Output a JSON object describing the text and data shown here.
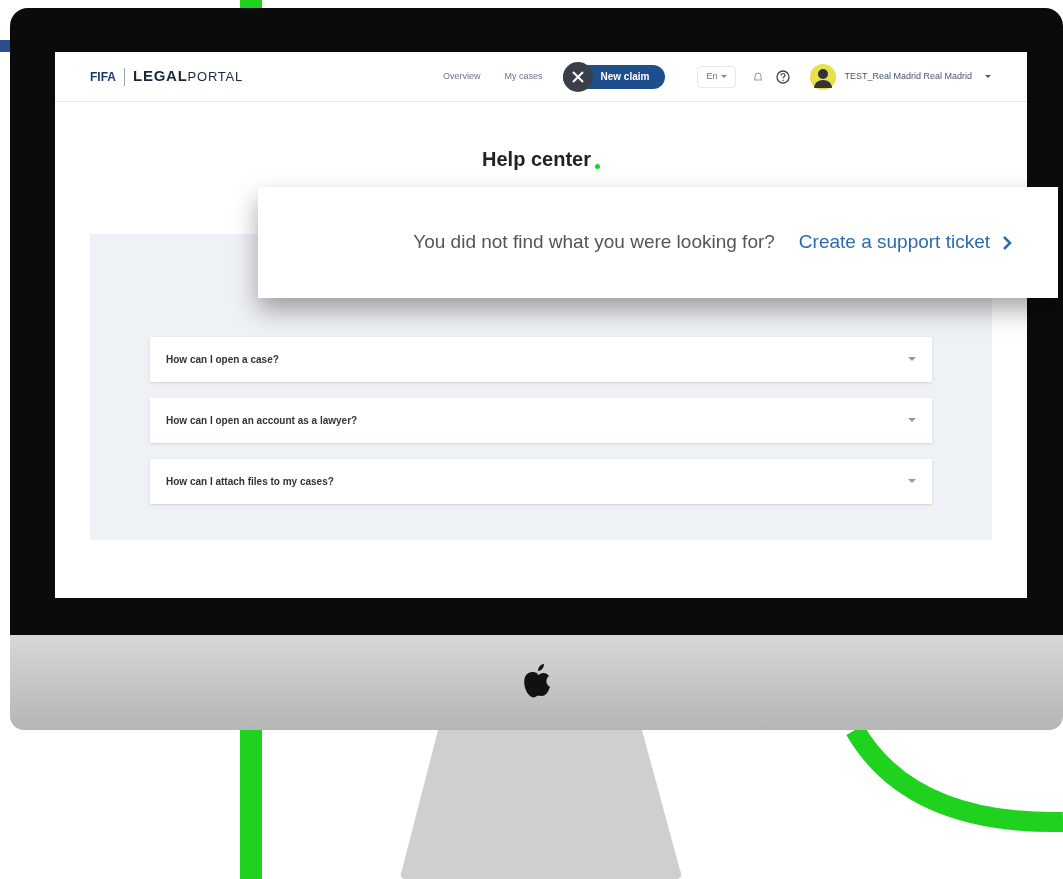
{
  "nav": {
    "logo_mark": "FIFA",
    "logo_bold": "LEGAL",
    "logo_light": "PORTAL",
    "links": [
      {
        "label": "Overview"
      },
      {
        "label": "My cases"
      }
    ],
    "primary_button": "New claim",
    "language": "En",
    "user": "TEST_Real Madrid Real Madrid"
  },
  "page_title": "Help center",
  "support_banner": {
    "text": "You did not find what you were looking for?",
    "link": "Create a support ticket"
  },
  "faq": [
    {
      "question": "How can I open a case?",
      "expanded": false
    },
    {
      "question": "How can I open an account as a lawyer?",
      "expanded": false
    },
    {
      "question": "How can I attach files to my cases?",
      "expanded": false
    }
  ]
}
